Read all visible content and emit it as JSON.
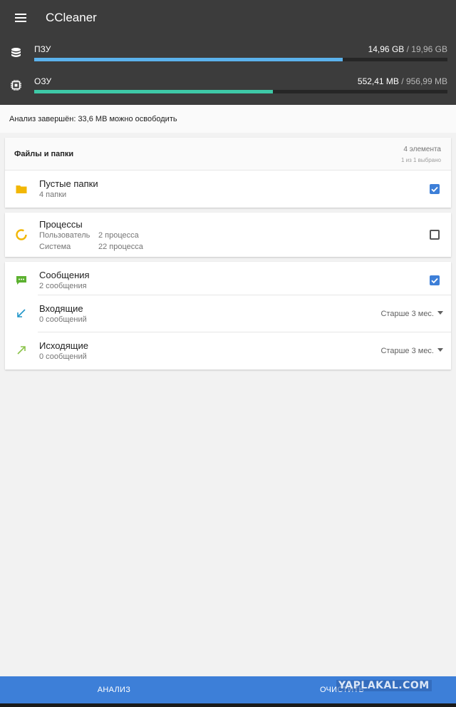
{
  "app": {
    "title": "CCleaner"
  },
  "storage": [
    {
      "label": "ПЗУ",
      "used": "14,96 GB",
      "sep": " / ",
      "total": "19,96 GB",
      "fraction": 0.747,
      "color": "#5bb2ec",
      "icon": "database-icon"
    },
    {
      "label": "ОЗУ",
      "used": "552,41 MB",
      "sep": " / ",
      "total": "956,99 MB",
      "fraction": 0.577,
      "color": "#3ec9a7",
      "icon": "chip-icon"
    }
  ],
  "status": {
    "text": "Анализ завершён: 33,6 MB можно освободить"
  },
  "files_card": {
    "title": "Файлы и папки",
    "count": "4 элемента",
    "selected": "1 из 1 выбрано",
    "rows": [
      {
        "title": "Пустые папки",
        "subtitle": "4 папки",
        "checked": true,
        "icon": "folder-icon"
      }
    ]
  },
  "processes_card": {
    "title": "Процессы",
    "checked": false,
    "icon": "process-ring-icon",
    "details": [
      {
        "label": "Пользователь",
        "value": "2 процесса"
      },
      {
        "label": "Система",
        "value": "22 процесса"
      }
    ]
  },
  "messages_card": {
    "title": "Сообщения",
    "subtitle": "2 сообщения",
    "checked": true,
    "icon": "message-icon",
    "rows": [
      {
        "title": "Входящие",
        "subtitle": "0 сообщений",
        "filter": "Старше 3 мес.",
        "icon": "arrow-incoming-icon"
      },
      {
        "title": "Исходящие",
        "subtitle": "0 сообщений",
        "filter": "Старше 3 мес.",
        "icon": "arrow-outgoing-icon"
      }
    ]
  },
  "bottom": {
    "analyze": "АНАЛИЗ",
    "clean": "ОЧИСТИТЬ"
  },
  "watermark": "YAPLAKAL.COM",
  "colors": {
    "header": "#3c3c3c",
    "accent": "#3d7fd8",
    "folder": "#f2b705",
    "message": "#5cb130",
    "incoming": "#2196c9",
    "outgoing": "#8bc34a",
    "process": "#f2b705"
  }
}
